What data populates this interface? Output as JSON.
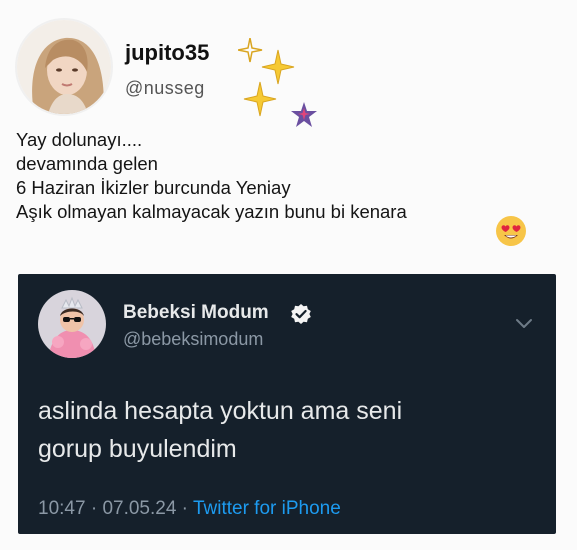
{
  "outer_post": {
    "display_name": "jupito35",
    "handle": "@nusseg",
    "lines": [
      "Yay dolunayı....",
      "devamında gelen",
      "6 Haziran İkizler burcunda Yeniay",
      "Aşık olmayan kalmayacak yazın bunu bi kenara"
    ],
    "emoji": "smiling-face-with-heart-eyes-icon"
  },
  "quoted_tweet": {
    "display_name": "Bebeksi Modum",
    "handle": "@bebeksimodum",
    "lines": [
      "aslinda hesapta yoktun ama seni",
      "gorup buyulendim"
    ],
    "time": "10:47",
    "separator": " · ",
    "date": "07.05.24",
    "source": "Twitter for iPhone"
  },
  "colors": {
    "card_bg": "#15202b",
    "accent": "#1d9bf0",
    "sparkle": "#f6c933",
    "star": "#6a4fa0"
  }
}
